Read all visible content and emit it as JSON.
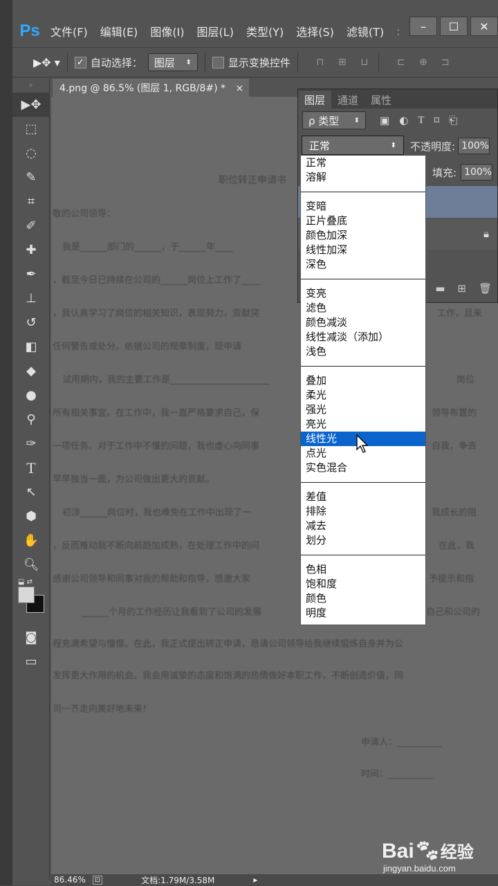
{
  "menubar": {
    "logo": "Ps",
    "items": [
      "文件(F)",
      "编辑(E)",
      "图像(I)",
      "图层(L)",
      "类型(Y)",
      "选择(S)",
      "滤镜(T)"
    ],
    "window_buttons": [
      "–",
      "☐",
      "✕"
    ]
  },
  "options_bar": {
    "auto_select_label": "自动选择：",
    "auto_select_value": "图层",
    "show_transform_label": "显示变换控件"
  },
  "document": {
    "tab_title": "4.png @ 86.5% (图层 1, RGB/8#) *",
    "tab_close": "×",
    "lines": [
      "职位转正申请书",
      "敬的公司领导：",
      "我是______部门的______，于______年____",
      "，截至今日已持续在公司的______岗位上工作了____",
      "，我认真学习了岗位的相关知识，表现努力，贡献突",
      "任何警告或处分。依据公司的规章制度，现申请",
      "试用期内，我的主要工作是______________________",
      "所有相关事宜。在工作中，我一直严格要求自己，保",
      "一项任务。对于工作中不懂的问题，我也虚心向同事",
      "早早独当一面，为公司做出更大的贡献。",
      "初涉______岗位时，我也难免在工作中出现了一",
      "，反而推动我不断向前趋加成熟，在处理工作中的问",
      "感谢公司领导和同事对我的帮助和指导，感激大家",
      "______个月的工作经历让我看到了公司的发展",
      "程充满希望与憧憬。在此，我正式提出转正申请，恳请公司领导给我继续锻炼自身并为公",
      "发挥更大作用的机会。我会用诚挚的态度和饱满的热情做好本职工作，不断创造价值，同",
      "司一齐走向美好地未来！",
      "申请人：__________",
      "时间：__________"
    ],
    "right_fragments": [
      "工作，且来",
      "领导布置的",
      "自我，争去",
      "我成长的阻",
      "在此，我",
      "予提示和指",
      "自己和公司的"
    ],
    "far_right_fragments": [
      "岗位"
    ]
  },
  "status_bar": {
    "zoom": "86.46%",
    "doc_info": "文档:1.79M/3.58M"
  },
  "layers_panel": {
    "tabs": [
      "图层",
      "通道",
      "属性"
    ],
    "filter_label": "ρ 类型",
    "opacity_label": "不透明度:",
    "opacity_value": "100%",
    "fill_label": "填充:",
    "fill_value": "100%"
  },
  "blend_mode": {
    "current": "正常",
    "groups": [
      [
        "正常",
        "溶解"
      ],
      [
        "变暗",
        "正片叠底",
        "颜色加深",
        "线性加深",
        "深色"
      ],
      [
        "变亮",
        "滤色",
        "颜色减淡",
        "线性减淡（添加）",
        "浅色"
      ],
      [
        "叠加",
        "柔光",
        "强光",
        "亮光",
        "线性光",
        "点光",
        "实色混合"
      ],
      [
        "差值",
        "排除",
        "减去",
        "划分"
      ],
      [
        "色相",
        "饱和度",
        "颜色",
        "明度"
      ]
    ],
    "highlighted": "线性光"
  },
  "watermark": {
    "brand": "Bai",
    "brand2": "经验",
    "url": "jingyan.baidu.com"
  },
  "colors": {
    "accent": "#31a8ff",
    "selection": "#0a64cc",
    "panel": "#535353",
    "canvas": "#6a6a6a"
  }
}
